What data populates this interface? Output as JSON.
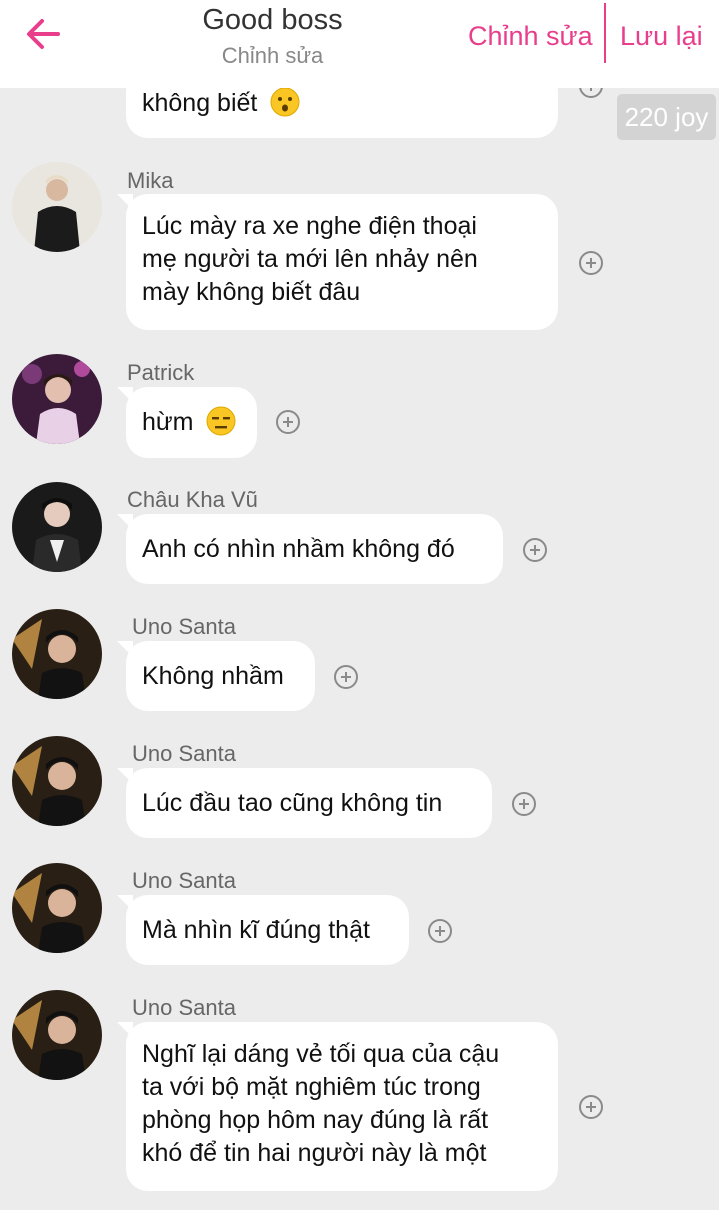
{
  "header": {
    "title": "Good boss",
    "subtitle": "Chỉnh sửa",
    "edit_label": "Chỉnh sửa",
    "save_label": "Lưu lại"
  },
  "joy_badge": "220 joy",
  "messages": [
    {
      "sender": "",
      "text": "không biết",
      "emoji": "face-with-open-mouth-icon"
    },
    {
      "sender": "Mika",
      "lines": [
        "Lúc mày ra xe nghe điện thoại",
        "mẹ người ta mới lên nhảy nên",
        "mày không biết đâu"
      ]
    },
    {
      "sender": "Patrick",
      "text": "hừm",
      "emoji": "expressionless-face-icon"
    },
    {
      "sender": "Châu Kha Vũ",
      "text": "Anh có nhìn nhầm không đó"
    },
    {
      "sender": "Uno Santa",
      "text": "Không nhầm"
    },
    {
      "sender": "Uno Santa",
      "text": "Lúc đầu tao cũng không tin"
    },
    {
      "sender": "Uno Santa",
      "text": "Mà nhìn kĩ đúng thật"
    },
    {
      "sender": "Uno Santa",
      "lines": [
        "Nghĩ lại dáng vẻ tối qua của cậu",
        "ta với bộ mặt nghiêm túc trong",
        "phòng họp hôm nay đúng là rất",
        "khó để tin hai người này là một"
      ]
    }
  ],
  "colors": {
    "accent": "#e83e8c",
    "background": "#ececec",
    "bubble": "#ffffff"
  }
}
